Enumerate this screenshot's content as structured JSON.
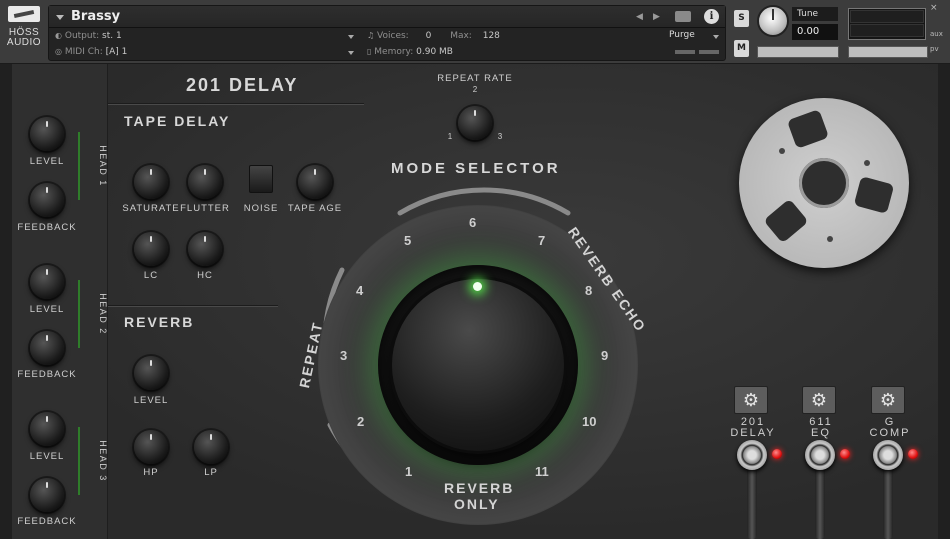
{
  "header": {
    "logo_line1": "HÖSS",
    "logo_line2": "AUDIO",
    "instrument_name": "Brassy",
    "output_label": "Output:",
    "output_value": "st. 1",
    "voices_label": "Voices:",
    "voices_value": "0",
    "max_label": "Max:",
    "max_value": "128",
    "purge_label": "Purge",
    "midi_label": "MIDI Ch:",
    "midi_value": "[A]  1",
    "memory_label": "Memory:",
    "memory_value": "0.90 MB",
    "solo_label": "S",
    "mute_label": "M",
    "tune_label": "Tune",
    "tune_value": "0.00",
    "close_label": "×",
    "aux_label": "aux",
    "pv_label": "pv"
  },
  "heads": [
    {
      "tag": "HEAD 1",
      "level_label": "LEVEL",
      "feedback_label": "FEEDBACK"
    },
    {
      "tag": "HEAD 2",
      "level_label": "LEVEL",
      "feedback_label": "FEEDBACK"
    },
    {
      "tag": "HEAD 3",
      "level_label": "LEVEL",
      "feedback_label": "FEEDBACK"
    }
  ],
  "plugin_title": "201 DELAY",
  "tape_delay": {
    "title": "TAPE DELAY",
    "saturate": "SATURATE",
    "flutter": "FLUTTER",
    "noise": "NOISE",
    "tape_age": "TAPE AGE",
    "lc": "LC",
    "hc": "HC"
  },
  "reverb": {
    "title": "REVERB",
    "level": "LEVEL",
    "hp": "HP",
    "lp": "LP"
  },
  "repeat_rate": {
    "label": "REPEAT RATE",
    "pos1": "1",
    "pos2": "2",
    "pos3": "3"
  },
  "mode_selector": {
    "title": "MODE SELECTOR",
    "numbers": [
      "1",
      "2",
      "3",
      "4",
      "5",
      "6",
      "7",
      "8",
      "9",
      "10",
      "11"
    ],
    "group_repeat": "REPEAT",
    "group_reverb_echo": "REVERB ECHO",
    "group_reverb_only_1": "REVERB",
    "group_reverb_only_2": "ONLY"
  },
  "fx_chain": [
    {
      "line1": "201",
      "line2": "DELAY"
    },
    {
      "line1": "611",
      "line2": "EQ"
    },
    {
      "line1": "G",
      "line2": "COMP"
    }
  ]
}
